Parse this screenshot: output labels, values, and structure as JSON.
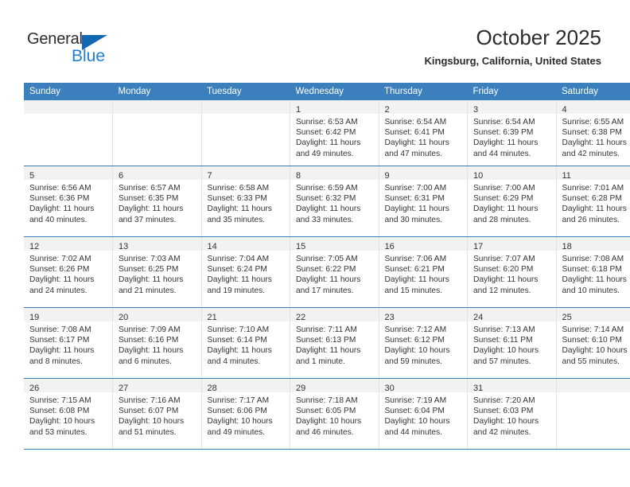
{
  "brand": {
    "name_part1": "General",
    "name_part2": "Blue",
    "color_dark": "#2b2b2b",
    "color_blue": "#1f7fd4",
    "triangle_color": "#1268b3"
  },
  "header": {
    "title": "October 2025",
    "location": "Kingsburg, California, United States"
  },
  "theme": {
    "header_bg": "#3c7fbd",
    "daynum_band_bg": "#f2f2f2",
    "row_border": "#3c7fbd",
    "cell_border": "#e3e3e3"
  },
  "weekday_headers": [
    "Sunday",
    "Monday",
    "Tuesday",
    "Wednesday",
    "Thursday",
    "Friday",
    "Saturday"
  ],
  "weeks": [
    [
      {
        "day": "",
        "empty": true
      },
      {
        "day": "",
        "empty": true
      },
      {
        "day": "",
        "empty": true
      },
      {
        "day": "1",
        "sunrise": "Sunrise: 6:53 AM",
        "sunset": "Sunset: 6:42 PM",
        "daylight1": "Daylight: 11 hours",
        "daylight2": "and 49 minutes."
      },
      {
        "day": "2",
        "sunrise": "Sunrise: 6:54 AM",
        "sunset": "Sunset: 6:41 PM",
        "daylight1": "Daylight: 11 hours",
        "daylight2": "and 47 minutes."
      },
      {
        "day": "3",
        "sunrise": "Sunrise: 6:54 AM",
        "sunset": "Sunset: 6:39 PM",
        "daylight1": "Daylight: 11 hours",
        "daylight2": "and 44 minutes."
      },
      {
        "day": "4",
        "sunrise": "Sunrise: 6:55 AM",
        "sunset": "Sunset: 6:38 PM",
        "daylight1": "Daylight: 11 hours",
        "daylight2": "and 42 minutes."
      }
    ],
    [
      {
        "day": "5",
        "sunrise": "Sunrise: 6:56 AM",
        "sunset": "Sunset: 6:36 PM",
        "daylight1": "Daylight: 11 hours",
        "daylight2": "and 40 minutes."
      },
      {
        "day": "6",
        "sunrise": "Sunrise: 6:57 AM",
        "sunset": "Sunset: 6:35 PM",
        "daylight1": "Daylight: 11 hours",
        "daylight2": "and 37 minutes."
      },
      {
        "day": "7",
        "sunrise": "Sunrise: 6:58 AM",
        "sunset": "Sunset: 6:33 PM",
        "daylight1": "Daylight: 11 hours",
        "daylight2": "and 35 minutes."
      },
      {
        "day": "8",
        "sunrise": "Sunrise: 6:59 AM",
        "sunset": "Sunset: 6:32 PM",
        "daylight1": "Daylight: 11 hours",
        "daylight2": "and 33 minutes."
      },
      {
        "day": "9",
        "sunrise": "Sunrise: 7:00 AM",
        "sunset": "Sunset: 6:31 PM",
        "daylight1": "Daylight: 11 hours",
        "daylight2": "and 30 minutes."
      },
      {
        "day": "10",
        "sunrise": "Sunrise: 7:00 AM",
        "sunset": "Sunset: 6:29 PM",
        "daylight1": "Daylight: 11 hours",
        "daylight2": "and 28 minutes."
      },
      {
        "day": "11",
        "sunrise": "Sunrise: 7:01 AM",
        "sunset": "Sunset: 6:28 PM",
        "daylight1": "Daylight: 11 hours",
        "daylight2": "and 26 minutes."
      }
    ],
    [
      {
        "day": "12",
        "sunrise": "Sunrise: 7:02 AM",
        "sunset": "Sunset: 6:26 PM",
        "daylight1": "Daylight: 11 hours",
        "daylight2": "and 24 minutes."
      },
      {
        "day": "13",
        "sunrise": "Sunrise: 7:03 AM",
        "sunset": "Sunset: 6:25 PM",
        "daylight1": "Daylight: 11 hours",
        "daylight2": "and 21 minutes."
      },
      {
        "day": "14",
        "sunrise": "Sunrise: 7:04 AM",
        "sunset": "Sunset: 6:24 PM",
        "daylight1": "Daylight: 11 hours",
        "daylight2": "and 19 minutes."
      },
      {
        "day": "15",
        "sunrise": "Sunrise: 7:05 AM",
        "sunset": "Sunset: 6:22 PM",
        "daylight1": "Daylight: 11 hours",
        "daylight2": "and 17 minutes."
      },
      {
        "day": "16",
        "sunrise": "Sunrise: 7:06 AM",
        "sunset": "Sunset: 6:21 PM",
        "daylight1": "Daylight: 11 hours",
        "daylight2": "and 15 minutes."
      },
      {
        "day": "17",
        "sunrise": "Sunrise: 7:07 AM",
        "sunset": "Sunset: 6:20 PM",
        "daylight1": "Daylight: 11 hours",
        "daylight2": "and 12 minutes."
      },
      {
        "day": "18",
        "sunrise": "Sunrise: 7:08 AM",
        "sunset": "Sunset: 6:18 PM",
        "daylight1": "Daylight: 11 hours",
        "daylight2": "and 10 minutes."
      }
    ],
    [
      {
        "day": "19",
        "sunrise": "Sunrise: 7:08 AM",
        "sunset": "Sunset: 6:17 PM",
        "daylight1": "Daylight: 11 hours",
        "daylight2": "and 8 minutes."
      },
      {
        "day": "20",
        "sunrise": "Sunrise: 7:09 AM",
        "sunset": "Sunset: 6:16 PM",
        "daylight1": "Daylight: 11 hours",
        "daylight2": "and 6 minutes."
      },
      {
        "day": "21",
        "sunrise": "Sunrise: 7:10 AM",
        "sunset": "Sunset: 6:14 PM",
        "daylight1": "Daylight: 11 hours",
        "daylight2": "and 4 minutes."
      },
      {
        "day": "22",
        "sunrise": "Sunrise: 7:11 AM",
        "sunset": "Sunset: 6:13 PM",
        "daylight1": "Daylight: 11 hours",
        "daylight2": "and 1 minute."
      },
      {
        "day": "23",
        "sunrise": "Sunrise: 7:12 AM",
        "sunset": "Sunset: 6:12 PM",
        "daylight1": "Daylight: 10 hours",
        "daylight2": "and 59 minutes."
      },
      {
        "day": "24",
        "sunrise": "Sunrise: 7:13 AM",
        "sunset": "Sunset: 6:11 PM",
        "daylight1": "Daylight: 10 hours",
        "daylight2": "and 57 minutes."
      },
      {
        "day": "25",
        "sunrise": "Sunrise: 7:14 AM",
        "sunset": "Sunset: 6:10 PM",
        "daylight1": "Daylight: 10 hours",
        "daylight2": "and 55 minutes."
      }
    ],
    [
      {
        "day": "26",
        "sunrise": "Sunrise: 7:15 AM",
        "sunset": "Sunset: 6:08 PM",
        "daylight1": "Daylight: 10 hours",
        "daylight2": "and 53 minutes."
      },
      {
        "day": "27",
        "sunrise": "Sunrise: 7:16 AM",
        "sunset": "Sunset: 6:07 PM",
        "daylight1": "Daylight: 10 hours",
        "daylight2": "and 51 minutes."
      },
      {
        "day": "28",
        "sunrise": "Sunrise: 7:17 AM",
        "sunset": "Sunset: 6:06 PM",
        "daylight1": "Daylight: 10 hours",
        "daylight2": "and 49 minutes."
      },
      {
        "day": "29",
        "sunrise": "Sunrise: 7:18 AM",
        "sunset": "Sunset: 6:05 PM",
        "daylight1": "Daylight: 10 hours",
        "daylight2": "and 46 minutes."
      },
      {
        "day": "30",
        "sunrise": "Sunrise: 7:19 AM",
        "sunset": "Sunset: 6:04 PM",
        "daylight1": "Daylight: 10 hours",
        "daylight2": "and 44 minutes."
      },
      {
        "day": "31",
        "sunrise": "Sunrise: 7:20 AM",
        "sunset": "Sunset: 6:03 PM",
        "daylight1": "Daylight: 10 hours",
        "daylight2": "and 42 minutes."
      },
      {
        "day": "",
        "empty": true
      }
    ]
  ]
}
